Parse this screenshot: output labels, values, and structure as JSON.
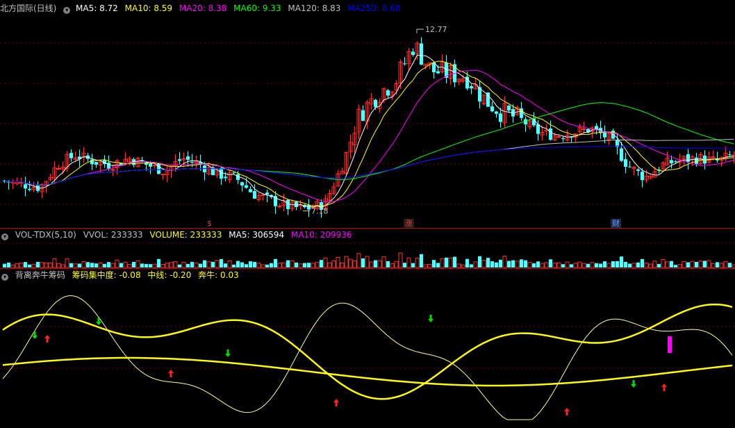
{
  "main_panel": {
    "title": "北方国际(日线)",
    "ma_labels": [
      {
        "text": "MA5: 8.72",
        "color": "#ffffff"
      },
      {
        "text": "MA10: 8.59",
        "color": "#ffff00"
      },
      {
        "text": "MA20: 8.38",
        "color": "#ff00ff"
      },
      {
        "text": "MA60: 9.33",
        "color": "#00ff00"
      },
      {
        "text": "MA120: 8.83",
        "color": "#c0c0c0"
      },
      {
        "text": "MA250: 8.60",
        "color": "#0000ff"
      }
    ],
    "high_label": "12.77",
    "low_label": "7.18",
    "events": [
      {
        "text": "$",
        "color": "#ff3030",
        "bg": "transparent"
      },
      {
        "text": "涨",
        "color": "#ff3030",
        "bg": "#202020"
      },
      {
        "text": "财",
        "color": "#6aa0ff",
        "bg": "#1a2a50"
      }
    ]
  },
  "volume_panel": {
    "labels": [
      {
        "text": "VOL-TDX(5,10)",
        "color": "#c0c0c0"
      },
      {
        "text": "VVOL: 233333",
        "color": "#c0c0c0"
      },
      {
        "text": "VOLUME: 233333",
        "color": "#ffff00"
      },
      {
        "text": "MA5: 306594",
        "color": "#ffffff"
      },
      {
        "text": "MA10: 209936",
        "color": "#ff00ff"
      }
    ]
  },
  "indicator_panel": {
    "labels": [
      {
        "text": "背离奔牛筹码",
        "color": "#c0c0c0"
      },
      {
        "text": "筹码集中度: -0.08",
        "color": "#ffff00"
      },
      {
        "text": "中线: -0.20",
        "color": "#ffff00"
      },
      {
        "text": "奔牛: 0.03",
        "color": "#ffff00"
      }
    ]
  },
  "colors": {
    "up": "#ff3232",
    "down": "#54ffff",
    "grid": "#7a0000",
    "ma5": "#ffffff",
    "ma10": "#ffff00",
    "ma20": "#ff00ff",
    "ma60": "#00ff00",
    "ma120": "#c0c0c0",
    "ma250": "#0000ff",
    "signal_buy": "#ff2020",
    "signal_sell": "#00dd00",
    "marker": "#ff00ff"
  },
  "chart_data": {
    "type": "candlestick",
    "price_range": [
      7.0,
      13.2
    ],
    "annotations": {
      "high": 12.77,
      "low": 7.18
    },
    "close_trend": [
      8.1,
      8.0,
      7.9,
      8.6,
      8.9,
      8.7,
      8.6,
      8.8,
      8.6,
      8.4,
      8.8,
      8.6,
      8.3,
      8.2,
      7.7,
      7.5,
      7.3,
      7.25,
      7.4,
      8.6,
      10.2,
      10.8,
      11.2,
      12.3,
      11.5,
      11.4,
      11.3,
      10.6,
      10.2,
      10.0,
      9.6,
      9.5,
      9.6,
      9.7,
      9.4,
      8.6,
      8.2,
      8.6,
      8.75,
      8.8,
      8.7,
      8.9
    ]
  }
}
